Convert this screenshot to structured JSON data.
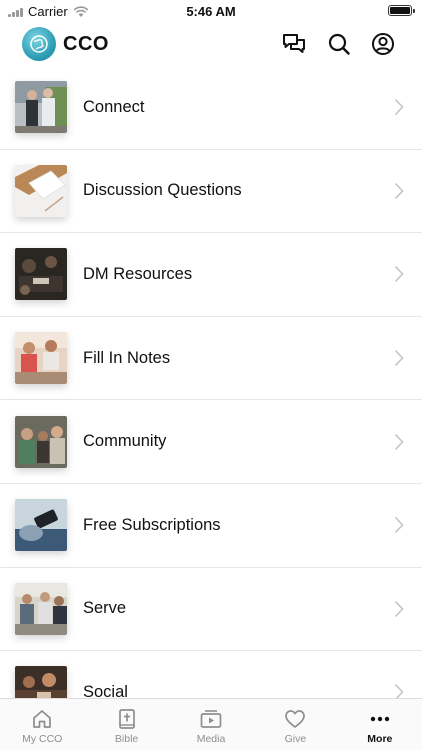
{
  "status_bar": {
    "carrier": "Carrier",
    "time": "5:46 AM",
    "battery_level": 1.0
  },
  "header": {
    "title": "CCO",
    "icons": [
      "chat-bubbles-icon",
      "search-icon",
      "account-icon"
    ]
  },
  "menu": [
    {
      "label": "Connect",
      "icon": "photo-thumbnail"
    },
    {
      "label": "Discussion Questions",
      "icon": "photo-thumbnail"
    },
    {
      "label": "DM Resources",
      "icon": "photo-thumbnail"
    },
    {
      "label": "Fill In Notes",
      "icon": "photo-thumbnail"
    },
    {
      "label": "Community",
      "icon": "photo-thumbnail"
    },
    {
      "label": "Free Subscriptions",
      "icon": "photo-thumbnail"
    },
    {
      "label": "Serve",
      "icon": "photo-thumbnail"
    },
    {
      "label": "Social",
      "icon": "photo-thumbnail"
    }
  ],
  "tabs": [
    {
      "label": "My CCO",
      "icon": "home-icon",
      "active": false
    },
    {
      "label": "Bible",
      "icon": "bible-icon",
      "active": false
    },
    {
      "label": "Media",
      "icon": "media-icon",
      "active": false
    },
    {
      "label": "Give",
      "icon": "heart-icon",
      "active": false
    },
    {
      "label": "More",
      "icon": "more-dots-icon",
      "active": true
    }
  ],
  "colors": {
    "accent": "#2f9fb7",
    "inactive_tab": "#8e8e8e",
    "active_tab": "#111111"
  }
}
